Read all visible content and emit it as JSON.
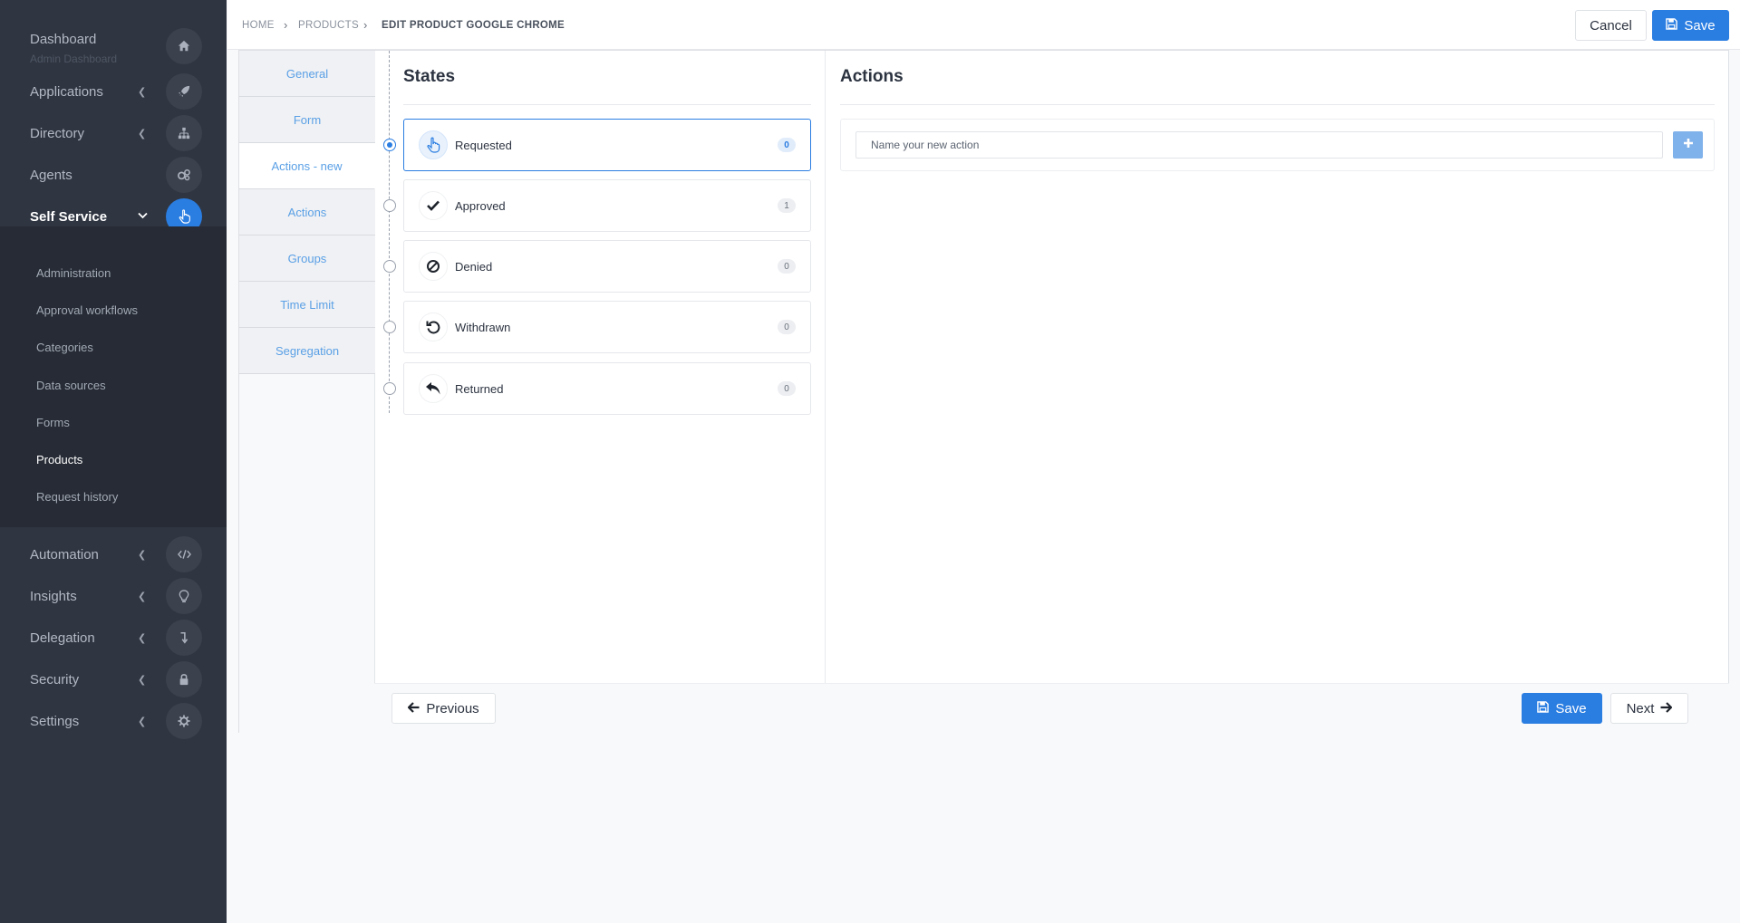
{
  "sidebar": {
    "dashboard": {
      "label": "Dashboard",
      "sub": "Admin Dashboard",
      "icon": "home-icon"
    },
    "items": [
      {
        "label": "Applications",
        "icon": "rocket-icon"
      },
      {
        "label": "Directory",
        "icon": "sitemap-icon"
      },
      {
        "label": "Agents",
        "icon": "cogs-icon"
      },
      {
        "label": "Self Service",
        "icon": "hand-pointer-icon"
      },
      {
        "label": "Automation",
        "icon": "code-icon"
      },
      {
        "label": "Insights",
        "icon": "lightbulb-icon"
      },
      {
        "label": "Delegation",
        "icon": "level-down-icon"
      },
      {
        "label": "Security",
        "icon": "lock-icon"
      },
      {
        "label": "Settings",
        "icon": "gear-icon"
      }
    ],
    "submenu": [
      "Administration",
      "Approval workflows",
      "Categories",
      "Data sources",
      "Forms",
      "Products",
      "Request history"
    ]
  },
  "breadcrumb": {
    "home": "HOME",
    "products": "PRODUCTS",
    "current": "EDIT PRODUCT GOOGLE CHROME"
  },
  "topbar": {
    "cancel": "Cancel",
    "save": "Save"
  },
  "tabs": [
    "General",
    "Form",
    "Actions - new",
    "Actions",
    "Groups",
    "Time Limit",
    "Segregation"
  ],
  "states": {
    "title": "States",
    "items": [
      {
        "label": "Requested",
        "count": "0",
        "icon": "hand-pointer-icon"
      },
      {
        "label": "Approved",
        "count": "1",
        "icon": "check-icon"
      },
      {
        "label": "Denied",
        "count": "0",
        "icon": "ban-icon"
      },
      {
        "label": "Withdrawn",
        "count": "0",
        "icon": "undo-icon"
      },
      {
        "label": "Returned",
        "count": "0",
        "icon": "reply-icon"
      }
    ]
  },
  "actions": {
    "title": "Actions",
    "placeholder": "Name your new action",
    "add_icon": "plus-icon"
  },
  "footer": {
    "previous": "Previous",
    "save": "Save",
    "next": "Next"
  },
  "colors": {
    "accent": "#2a7de1",
    "sidebar": "#2f3541",
    "submenu": "#262b35",
    "tab_text": "#5aa0e6"
  }
}
